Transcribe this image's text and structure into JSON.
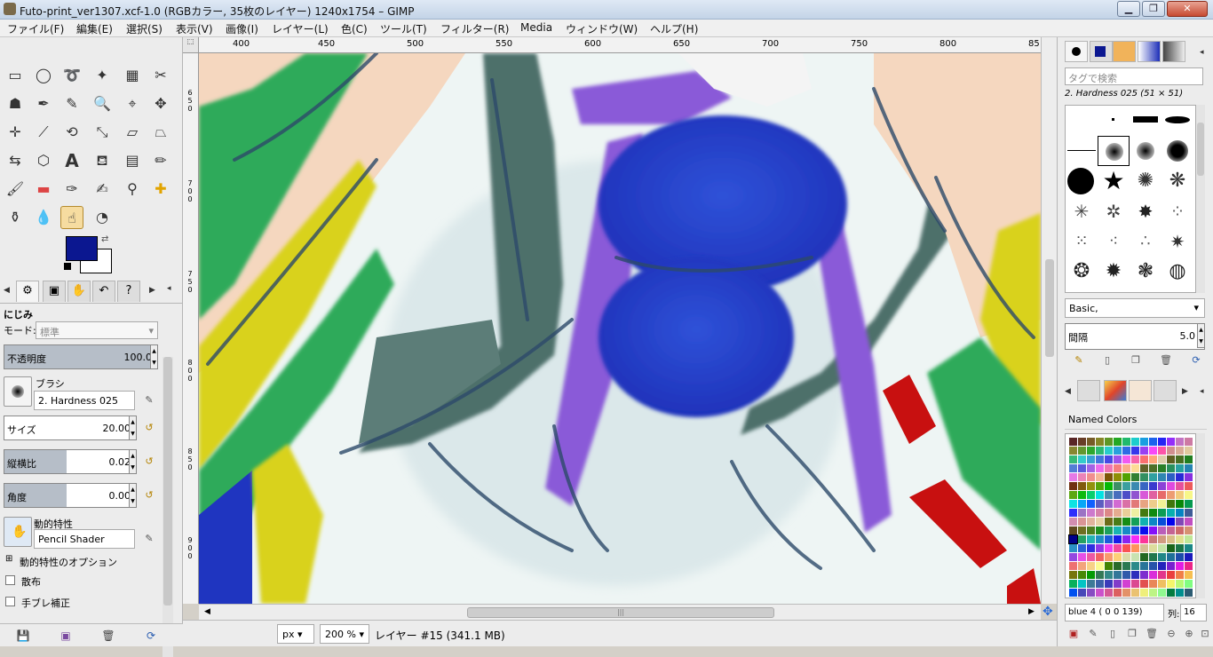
{
  "window": {
    "title": "Futo-print_ver1307.xcf-1.0 (RGBカラー, 35枚のレイヤー) 1240x1754 – GIMP",
    "minimize": "▁",
    "maximize": "❐",
    "close": "✕"
  },
  "menu": [
    "ファイル(F)",
    "編集(E)",
    "選択(S)",
    "表示(V)",
    "画像(I)",
    "レイヤー(L)",
    "色(C)",
    "ツール(T)",
    "フィルター(R)",
    "Media",
    "ウィンドウ(W)",
    "ヘルプ(H)"
  ],
  "colors": {
    "foreground": "#0b1790",
    "background": "#ffffff"
  },
  "tool_options": {
    "title": "にじみ",
    "mode_label": "モード:",
    "mode_value": "標準",
    "opacity_label": "不透明度",
    "opacity_value": "100.0",
    "opacity_fraction": 1.0,
    "brush_label": "ブラシ",
    "brush_value": "2. Hardness 025",
    "size_label": "サイズ",
    "size_value": "20.00",
    "size_fraction": 1.0,
    "aspect_label": "縦横比",
    "aspect_value": "0.02",
    "aspect_fraction": 0.47,
    "angle_label": "角度",
    "angle_value": "0.00",
    "angle_fraction": 0.47,
    "dynamics_label": "動的特性",
    "dynamics_value": "Pencil Shader",
    "dynamics_options": "動的特性のオプション",
    "scatter": "散布",
    "smoothing": "手ブレ補正"
  },
  "ruler": {
    "top_labels": [
      "400",
      "450",
      "500",
      "550",
      "600",
      "650",
      "700",
      "750",
      "800",
      "85"
    ],
    "left_labels": [
      "6\n5\n0",
      "7\n0\n0",
      "7\n5\n0",
      "8\n0\n0",
      "8\n5\n0",
      "9\n0\n0"
    ]
  },
  "status": {
    "unit": "px",
    "zoom": "200 %",
    "layer_info": "レイヤー #15 (341.1 MB)"
  },
  "brushes": {
    "tag_placeholder": "タグで検索",
    "current": "2. Hardness 025 (51 × 51)",
    "tag_value": "Basic,",
    "spacing_label": "間隔",
    "spacing_value": "5.0"
  },
  "palette": {
    "name": "Named Colors",
    "entry": "blue 4 (  0   0 139)",
    "columns_label": "列:",
    "columns_value": "16"
  }
}
